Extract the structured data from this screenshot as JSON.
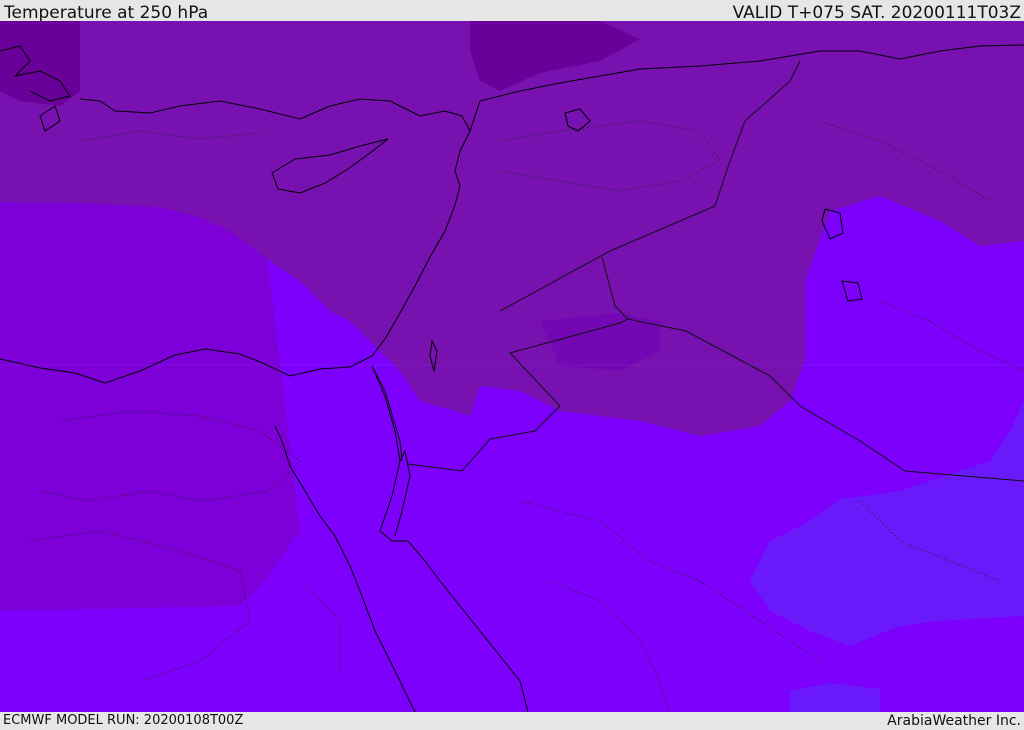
{
  "header": {
    "title": "Temperature at 250 hPa",
    "valid": "VALID T+075 SAT. 20200111T03Z"
  },
  "footer": {
    "model_run": "ECMWF MODEL RUN: 20200108T00Z",
    "credit": "ArabiaWeather Inc."
  },
  "map": {
    "field": "temperature",
    "level": "250 hPa",
    "colors": {
      "band_coldest": "#690099",
      "band_cold": "#7711b0",
      "band_mid": "#7d00d8",
      "band_warm": "#7c00fc",
      "band_warmest": "#6a19fb",
      "coastline": "#000000",
      "border": "#111111"
    }
  }
}
